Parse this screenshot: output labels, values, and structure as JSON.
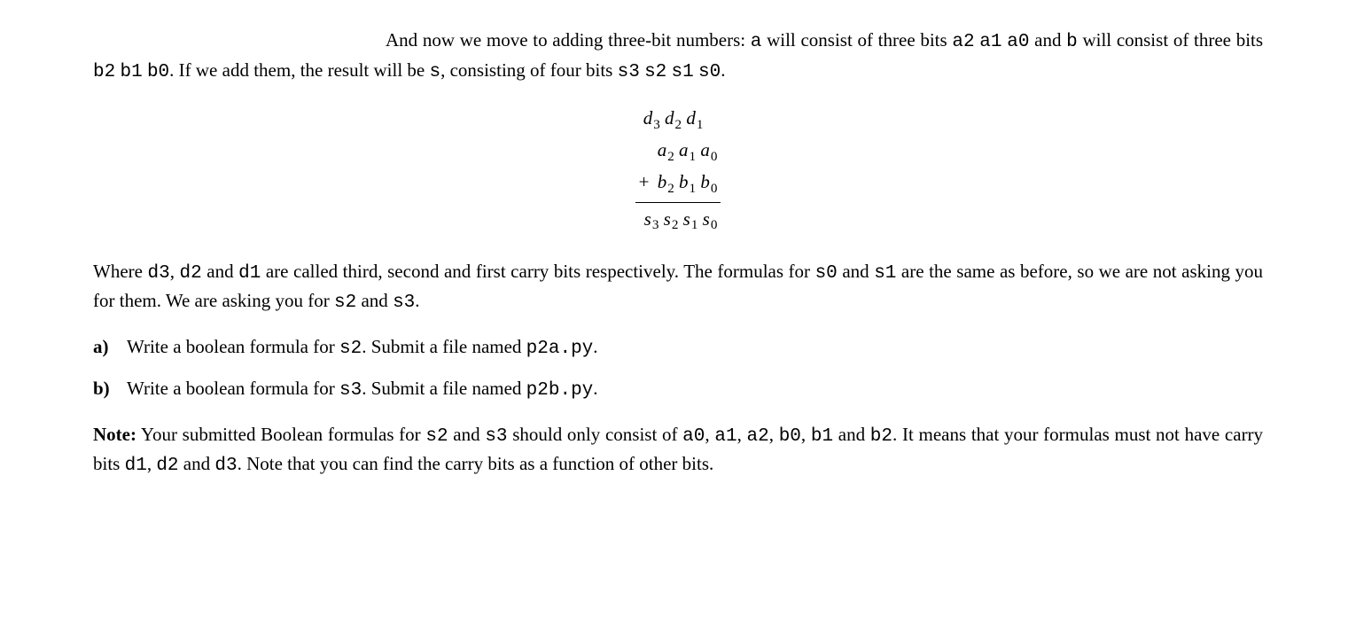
{
  "para1": {
    "lead": "And now we move to adding three-bit numbers: ",
    "a": "a",
    "t2": " will consist of three bits ",
    "a2": "a2",
    "a1": "a1",
    "a0": "a0",
    "t3": " and ",
    "b": "b",
    "t4": " will consist of three bits ",
    "b2": "b2",
    "b1": "b1",
    "b0": "b0",
    "t5": ".  If we add them, the result will be ",
    "s": "s",
    "t6": ", consisting of four bits ",
    "s3": "s3",
    "s2": "s2",
    "s1": "s1",
    "s0": "s0",
    "t7": "."
  },
  "math": {
    "carries": "d₃ d₂ d₁",
    "row_a": "a₂ a₁ a₀",
    "plus": "+",
    "row_b": "b₂ b₁ b₀",
    "row_s": "s₃ s₂ s₁ s₀"
  },
  "para2": {
    "t1": "Where ",
    "d3": "d3",
    "c1": ", ",
    "d2": "d2",
    "t2": " and ",
    "d1": "d1",
    "t3": " are called third, second and first carry bits respectively. The formulas for ",
    "s0": "s0",
    "t4": " and ",
    "s1": "s1",
    "t5": " are the same as before, so we are not asking you for them. We are asking you for ",
    "s2": "s2",
    "t6": " and ",
    "s3": "s3",
    "t7": "."
  },
  "item_a": {
    "label": "a)",
    "t1": "Write a boolean formula for ",
    "v": "s2",
    "t2": ". Submit a file named ",
    "f": "p2a.py",
    "t3": "."
  },
  "item_b": {
    "label": "b)",
    "t1": "Write a boolean formula for ",
    "v": "s3",
    "t2": ". Submit a file named ",
    "f": "p2b.py",
    "t3": "."
  },
  "note": {
    "label": "Note:",
    "t1": " Your submitted Boolean formulas for ",
    "s2": "s2",
    "t2": " and ",
    "s3": "s3",
    "t3": " should only consist of ",
    "a0": "a0",
    "c1": ", ",
    "a1": "a1",
    "c2": ", ",
    "a2": "a2",
    "c3": ", ",
    "b0": "b0",
    "c4": ", ",
    "b1": "b1",
    "t4": " and ",
    "b2": "b2",
    "t5": ". It means that your formulas must not have carry bits ",
    "d1": "d1",
    "c5": ", ",
    "d2": "d2",
    "t6": " and ",
    "d3": "d3",
    "t7": ". Note that you can find the carry bits as a function of other bits."
  }
}
